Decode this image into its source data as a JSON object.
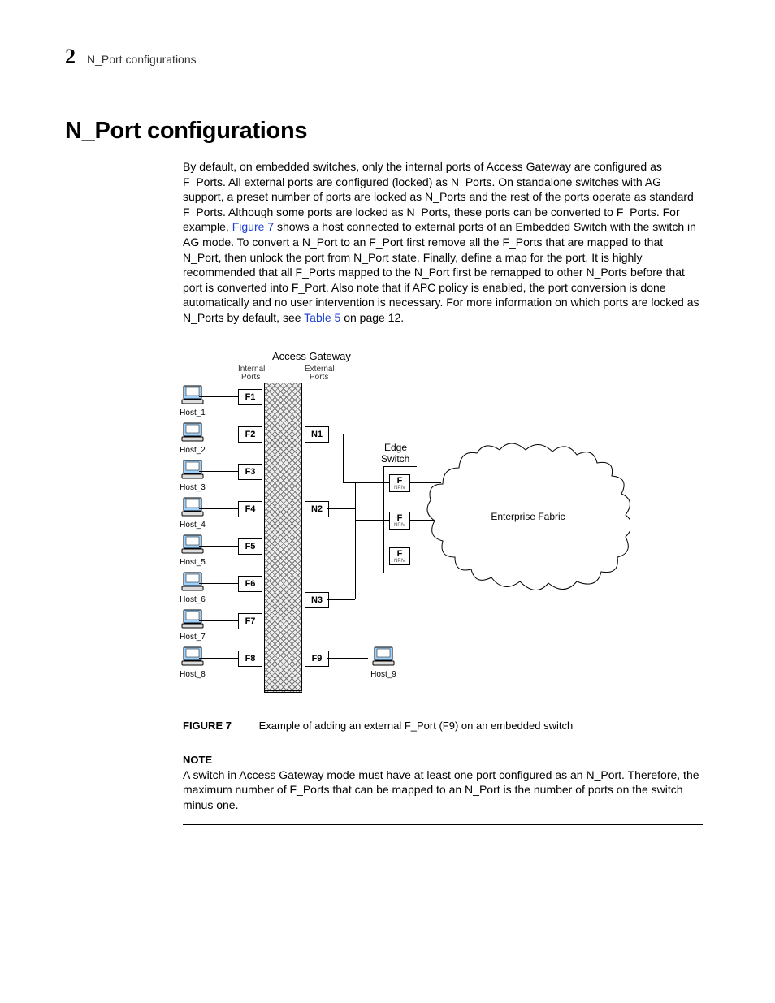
{
  "header": {
    "chapter_number": "2",
    "running_title": "N_Port configurations"
  },
  "heading": "N_Port configurations",
  "paragraph": {
    "pre": "By default, on embedded switches, only the internal ports of Access Gateway are configured as F_Ports. All external ports are configured (locked) as N_Ports. On standalone switches with AG support, a preset number of ports are locked as N_Ports and the rest of the ports operate as standard F_Ports. Although some ports are locked as N_Ports, these ports can be converted to F_Ports. For example, ",
    "link1": "Figure 7",
    "mid": " shows a host connected to external ports of an Embedded Switch with the switch in AG mode. To convert a N_Port to an F_Port first remove all the F_Ports that are mapped to that N_Port, then unlock the port from N_Port state. Finally, define a map for the port. It is highly recommended that all F_Ports mapped to the N_Port first be remapped to other N_Ports before that port is converted into F_Port. Also note that if APC policy is enabled, the port conversion is done automatically and no user intervention is necessary. For more information on which ports are locked as N_Ports by default, see ",
    "link2": "Table 5",
    "post": " on page 12."
  },
  "figure": {
    "title_top": "Access Gateway",
    "internal_label": "Internal",
    "ports_label": "Ports",
    "external_label": "External",
    "edge1": "Edge",
    "edge2": "Switch",
    "fabric": "Enterprise Fabric",
    "hosts": [
      "Host_1",
      "Host_2",
      "Host_3",
      "Host_4",
      "Host_5",
      "Host_6",
      "Host_7",
      "Host_8"
    ],
    "host9": "Host_9",
    "fports": [
      "F1",
      "F2",
      "F3",
      "F4",
      "F5",
      "F6",
      "F7",
      "F8"
    ],
    "nports": [
      "N1",
      "N2",
      "N3"
    ],
    "f9": "F9",
    "edge_f": "F",
    "caption_label": "FIGURE 7",
    "caption_text": "Example of adding an external F_Port (F9) on an embedded switch"
  },
  "note": {
    "label": "NOTE",
    "text": "A switch in Access Gateway mode must have at least one port configured as an N_Port. Therefore, the maximum number of F_Ports that can be mapped to an N_Port is the number of ports on the switch minus one."
  }
}
